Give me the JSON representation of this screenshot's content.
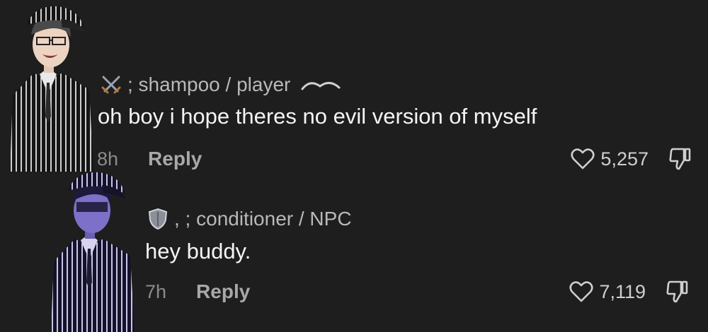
{
  "comments": [
    {
      "badge_icon": "crossed-swords-icon",
      "username": "; shampoo / player",
      "author_mark_icon": "creator-squiggle-icon",
      "text": "oh boy i hope theres no evil version of myself",
      "time": "8h",
      "reply_label": "Reply",
      "likes": "5,257"
    },
    {
      "badge_icon": "shield-icon",
      "username": ", ; conditioner / NPC",
      "text": "hey buddy.",
      "time": "7h",
      "reply_label": "Reply",
      "likes": "7,119"
    }
  ],
  "colors": {
    "background": "#1e1e1e",
    "text_primary": "#f4f4f4",
    "text_secondary": "#b9b9b9",
    "text_muted": "#8c8c8c"
  }
}
